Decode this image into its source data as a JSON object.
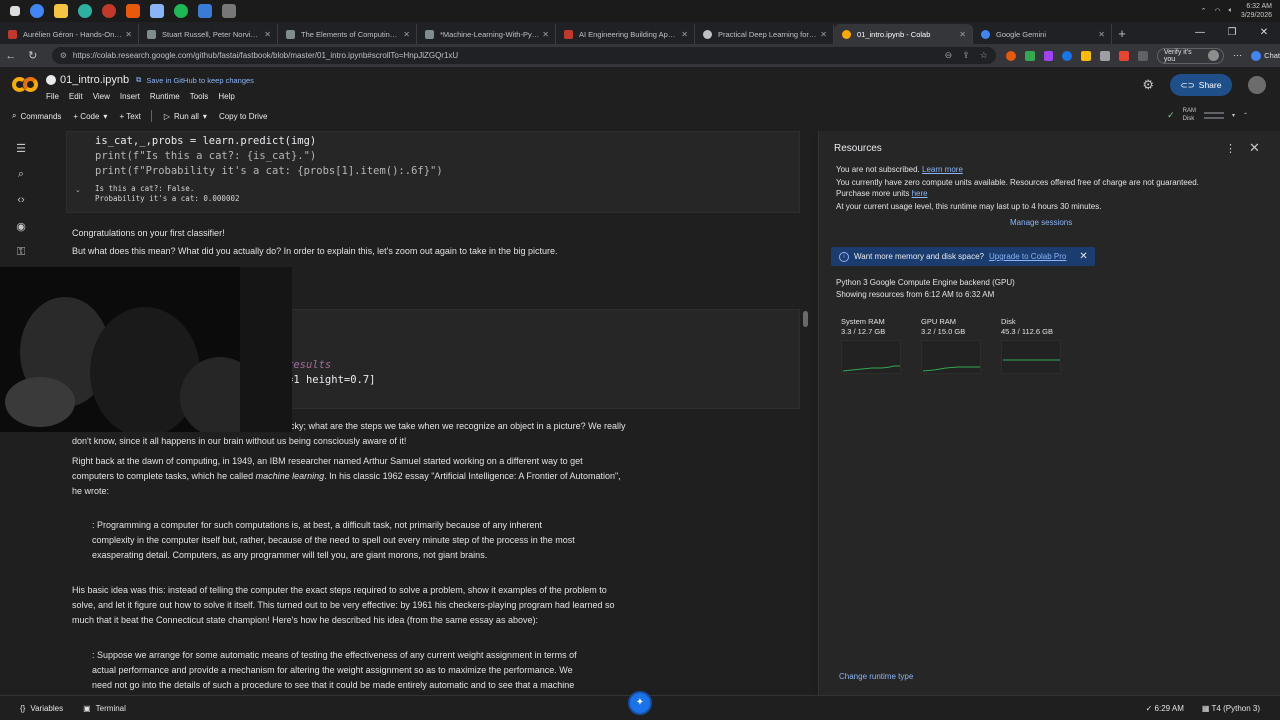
{
  "os": {
    "time": "6:32 AM",
    "date": "3/29/2026"
  },
  "browser": {
    "tabs": [
      {
        "title": "Aurélien Géron - Hands-On Machi",
        "color": "#c0392b"
      },
      {
        "title": "Stuart Russell, Peter Norvig - Artifi",
        "color": "#7f8c8d"
      },
      {
        "title": "The Elements of Computing System",
        "color": "#7f8c8d"
      },
      {
        "title": "*Machine-Learning-With-PyTorch",
        "color": "#7f8c8d"
      },
      {
        "title": "AI Engineering Building Applicatio",
        "color": "#c0392b"
      },
      {
        "title": "Practical Deep Learning for Coder",
        "color": "#bdc1c6"
      },
      {
        "title": "01_intro.ipynb - Colab",
        "color": "#f9ab00"
      },
      {
        "title": "Google Gemini",
        "color": "#4285f4"
      }
    ],
    "url": "https://colab.research.google.com/github/fastai/fastbook/blob/master/01_intro.ipynb#scrollTo=HnpJlZGQr1xU",
    "verify_label": "Verify it's you",
    "chat_label": "Chat"
  },
  "colab": {
    "notebook_title": "01_intro.ipynb",
    "save_link": "Save in GitHub to keep changes",
    "menu": [
      "File",
      "Edit",
      "View",
      "Insert",
      "Runtime",
      "Tools",
      "Help"
    ],
    "share_label": "Share",
    "toolbar": {
      "commands": "Commands",
      "code": "+ Code",
      "text": "+ Text",
      "run_all": "Run all",
      "copy_drive": "Copy to Drive",
      "ram": "RAM",
      "disk": "Disk"
    }
  },
  "notebook": {
    "code_lines": [
      "is_cat,_,probs = learn.predict(img)",
      "print(f\"Is this a cat?: {is_cat}.\")",
      "print(f\"Probability it's a cat: {probs[1].item():.6f}\")"
    ],
    "output_lines": [
      "Is this a cat?: False.",
      "Probability it's a cat: 0.000002"
    ],
    "md_congrats": "Congratulations on your first classifier!",
    "md_but": "But what does this mean? What did you actually do? In order to explain this, let's zoom out again to take in the big picture.",
    "partial_code_1": "results",
    "partial_code_2": "=1 height=0.7]",
    "md_tricky_1": "cky; what are the steps we take when we recognize an object in a picture? We really",
    "md_tricky_2": "don't know, since it all happens in our brain without us being consciously aware of it!",
    "md_samuel_1": "Right back at the dawn of computing, in 1949, an IBM researcher named Arthur Samuel started working on a different way to get",
    "md_samuel_2_pre": "computers to complete tasks, which he called ",
    "md_samuel_2_em": "machine learning",
    "md_samuel_2_post": ". In his classic 1962 essay \"Artificial Intelligence: A Frontier of Automation\",",
    "md_samuel_3": "he wrote:",
    "quote1": [
      ": Programming a computer for such computations is, at best, a difficult task, not primarily because of any inherent",
      "complexity in the computer itself but, rather, because of the need to spell out every minute step of the process in the most",
      "exasperating detail. Computers, as any programmer will tell you, are giant morons, not giant brains."
    ],
    "md_idea": [
      "His basic idea was this: instead of telling the computer the exact steps required to solve a problem, show it examples of the problem to",
      "solve, and let it figure out how to solve it itself. This turned out to be very effective: by 1961 his checkers-playing program had learned so",
      "much that it beat the Connecticut state champion! Here's how he described his idea (from the same essay as above):"
    ],
    "quote2": [
      ": Suppose we arrange for some automatic means of testing the effectiveness of any current weight assignment in terms of",
      "actual performance and provide a mechanism for altering the weight assignment so as to maximize the performance. We",
      "need not go into the details of such a procedure to see that it could be made entirely automatic and to see that a machine"
    ]
  },
  "resources": {
    "title": "Resources",
    "not_subscribed": "You are not subscribed.",
    "learn_more": "Learn more",
    "units_line": "You currently have zero compute units available. Resources offered free of charge are not guaranteed.",
    "purchase_pre": "Purchase more units ",
    "purchase_link": "here",
    "usage_line": "At your current usage level, this runtime may last up to 4 hours 30 minutes.",
    "manage_sessions": "Manage sessions",
    "upsell_text": "Want more memory and disk space?",
    "upsell_link": "Upgrade to Colab Pro",
    "backend": "Python 3 Google Compute Engine backend (GPU)",
    "showing": "Showing resources from 6:12 AM to 6:32 AM",
    "gauges": [
      {
        "label": "System RAM",
        "value": "3.3 / 12.7 GB"
      },
      {
        "label": "GPU RAM",
        "value": "3.2 / 15.0 GB"
      },
      {
        "label": "Disk",
        "value": "45.3 / 112.6 GB"
      }
    ],
    "change_runtime": "Change runtime type"
  },
  "bottom": {
    "variables": "Variables",
    "terminal": "Terminal",
    "time": "6:29 AM",
    "runtime": "T4 (Python 3)"
  }
}
